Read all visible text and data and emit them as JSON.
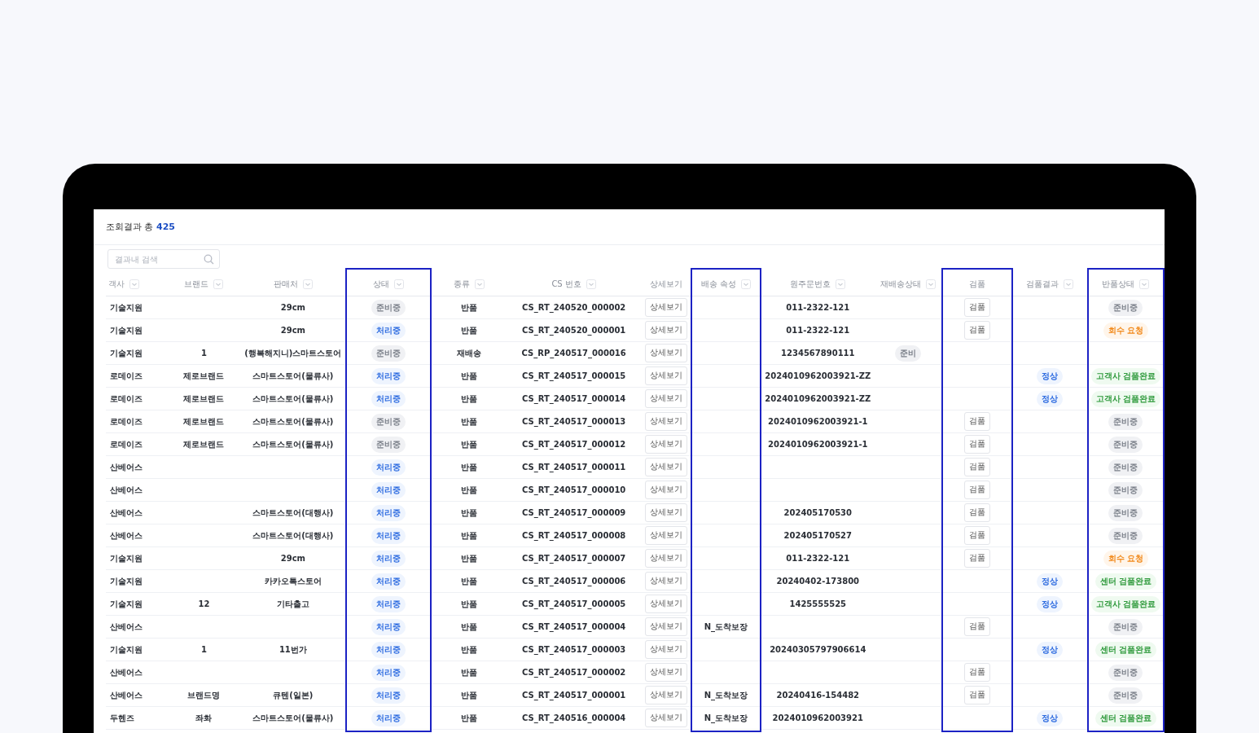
{
  "result_summary": {
    "label": "조회결과 총",
    "count": "425"
  },
  "search": {
    "placeholder": "결과내 검색"
  },
  "columns": [
    {
      "label": "객사",
      "sortable": true,
      "highlighted": false
    },
    {
      "label": "브랜드",
      "sortable": true,
      "highlighted": false
    },
    {
      "label": "판매처",
      "sortable": true,
      "highlighted": false
    },
    {
      "label": "상태",
      "sortable": true,
      "highlighted": true
    },
    {
      "label": "종류",
      "sortable": true,
      "highlighted": false
    },
    {
      "label": "CS 번호",
      "sortable": true,
      "highlighted": false
    },
    {
      "label": "상세보기",
      "sortable": false,
      "highlighted": false
    },
    {
      "label": "배송 속성",
      "sortable": true,
      "highlighted": true
    },
    {
      "label": "원주문번호",
      "sortable": true,
      "highlighted": false
    },
    {
      "label": "재배송상태",
      "sortable": true,
      "highlighted": false
    },
    {
      "label": "검품",
      "sortable": false,
      "highlighted": true
    },
    {
      "label": "검품결과",
      "sortable": true,
      "highlighted": false
    },
    {
      "label": "반품상태",
      "sortable": true,
      "highlighted": true
    }
  ],
  "rows": [
    {
      "customer": "기술지원",
      "seller": "29cm",
      "status": {
        "label": "준비중",
        "kind": "ready"
      },
      "type": "반품",
      "cs_no": "CS_RT_240520_000002",
      "detail": "상세보기",
      "order_no": "011-2322-121",
      "inspect": "검품",
      "return_status": {
        "label": "준비중",
        "kind": "ready"
      }
    },
    {
      "customer": "기술지원",
      "seller": "29cm",
      "status": {
        "label": "처리중",
        "kind": "processing"
      },
      "type": "반품",
      "cs_no": "CS_RT_240520_000001",
      "detail": "상세보기",
      "order_no": "011-2322-121",
      "inspect": "검품",
      "return_status": {
        "label": "회수 요청",
        "kind": "pickup"
      }
    },
    {
      "customer": "기술지원",
      "brand": "1",
      "seller": "(행복해지니)스마트스토어",
      "status": {
        "label": "준비중",
        "kind": "ready"
      },
      "type": "재배송",
      "cs_no": "CS_RP_240517_000016",
      "detail": "상세보기",
      "order_no": "1234567890111",
      "reship_status": {
        "label": "준비",
        "kind": "ready"
      }
    },
    {
      "customer": "로데이즈",
      "brand": "제로브랜드",
      "seller": "스마트스토어(물류사)",
      "status": {
        "label": "처리중",
        "kind": "processing"
      },
      "type": "반품",
      "cs_no": "CS_RT_240517_000015",
      "detail": "상세보기",
      "order_no": "2024010962003921-ZZ",
      "inspect_result": {
        "label": "정상",
        "kind": "processing"
      },
      "return_status": {
        "label": "고객사 검품완료",
        "kind": "complete"
      }
    },
    {
      "customer": "로데이즈",
      "brand": "제로브랜드",
      "seller": "스마트스토어(물류사)",
      "status": {
        "label": "처리중",
        "kind": "processing"
      },
      "type": "반품",
      "cs_no": "CS_RT_240517_000014",
      "detail": "상세보기",
      "order_no": "2024010962003921-ZZ",
      "inspect_result": {
        "label": "정상",
        "kind": "processing"
      },
      "return_status": {
        "label": "고객사 검품완료",
        "kind": "complete"
      }
    },
    {
      "customer": "로데이즈",
      "brand": "제로브랜드",
      "seller": "스마트스토어(물류사)",
      "status": {
        "label": "준비중",
        "kind": "ready"
      },
      "type": "반품",
      "cs_no": "CS_RT_240517_000013",
      "detail": "상세보기",
      "order_no": "2024010962003921-1",
      "inspect": "검품",
      "return_status": {
        "label": "준비중",
        "kind": "ready"
      }
    },
    {
      "customer": "로데이즈",
      "brand": "제로브랜드",
      "seller": "스마트스토어(물류사)",
      "status": {
        "label": "준비중",
        "kind": "ready"
      },
      "type": "반품",
      "cs_no": "CS_RT_240517_000012",
      "detail": "상세보기",
      "order_no": "2024010962003921-1",
      "inspect": "검품",
      "return_status": {
        "label": "준비중",
        "kind": "ready"
      }
    },
    {
      "customer": "산베어스",
      "status": {
        "label": "처리중",
        "kind": "processing"
      },
      "type": "반품",
      "cs_no": "CS_RT_240517_000011",
      "detail": "상세보기",
      "inspect": "검품",
      "return_status": {
        "label": "준비중",
        "kind": "ready"
      }
    },
    {
      "customer": "산베어스",
      "status": {
        "label": "처리중",
        "kind": "processing"
      },
      "type": "반품",
      "cs_no": "CS_RT_240517_000010",
      "detail": "상세보기",
      "inspect": "검품",
      "return_status": {
        "label": "준비중",
        "kind": "ready"
      }
    },
    {
      "customer": "산베어스",
      "seller": "스마트스토어(대행사)",
      "status": {
        "label": "처리중",
        "kind": "processing"
      },
      "type": "반품",
      "cs_no": "CS_RT_240517_000009",
      "detail": "상세보기",
      "order_no": "202405170530",
      "inspect": "검품",
      "return_status": {
        "label": "준비중",
        "kind": "ready"
      }
    },
    {
      "customer": "산베어스",
      "seller": "스마트스토어(대행사)",
      "status": {
        "label": "처리중",
        "kind": "processing"
      },
      "type": "반품",
      "cs_no": "CS_RT_240517_000008",
      "detail": "상세보기",
      "order_no": "202405170527",
      "inspect": "검품",
      "return_status": {
        "label": "준비중",
        "kind": "ready"
      }
    },
    {
      "customer": "기술지원",
      "seller": "29cm",
      "status": {
        "label": "처리중",
        "kind": "processing"
      },
      "type": "반품",
      "cs_no": "CS_RT_240517_000007",
      "detail": "상세보기",
      "order_no": "011-2322-121",
      "inspect": "검품",
      "return_status": {
        "label": "회수 요청",
        "kind": "pickup"
      }
    },
    {
      "customer": "기술지원",
      "seller": "카카오톡스토어",
      "status": {
        "label": "처리중",
        "kind": "processing"
      },
      "type": "반품",
      "cs_no": "CS_RT_240517_000006",
      "detail": "상세보기",
      "order_no": "20240402-173800",
      "inspect_result": {
        "label": "정상",
        "kind": "processing"
      },
      "return_status": {
        "label": "센터 검품완료",
        "kind": "complete"
      }
    },
    {
      "customer": "기술지원",
      "brand": "12",
      "seller": "기타출고",
      "status": {
        "label": "처리중",
        "kind": "processing"
      },
      "type": "반품",
      "cs_no": "CS_RT_240517_000005",
      "detail": "상세보기",
      "order_no": "1425555525",
      "inspect_result": {
        "label": "정상",
        "kind": "processing"
      },
      "return_status": {
        "label": "고객사 검품완료",
        "kind": "complete"
      }
    },
    {
      "customer": "산베어스",
      "status": {
        "label": "처리중",
        "kind": "processing"
      },
      "type": "반품",
      "cs_no": "CS_RT_240517_000004",
      "detail": "상세보기",
      "delivery_attr": "N_도착보장",
      "inspect": "검품",
      "return_status": {
        "label": "준비중",
        "kind": "ready"
      }
    },
    {
      "customer": "기술지원",
      "brand": "1",
      "seller": "11번가",
      "status": {
        "label": "처리중",
        "kind": "processing"
      },
      "type": "반품",
      "cs_no": "CS_RT_240517_000003",
      "detail": "상세보기",
      "order_no": "20240305797906614",
      "inspect_result": {
        "label": "정상",
        "kind": "processing"
      },
      "return_status": {
        "label": "센터 검품완료",
        "kind": "complete"
      }
    },
    {
      "customer": "산베어스",
      "status": {
        "label": "처리중",
        "kind": "processing"
      },
      "type": "반품",
      "cs_no": "CS_RT_240517_000002",
      "detail": "상세보기",
      "inspect": "검품",
      "return_status": {
        "label": "준비중",
        "kind": "ready"
      }
    },
    {
      "customer": "산베어스",
      "brand": "브랜드명",
      "seller": "큐텐(일본)",
      "status": {
        "label": "처리중",
        "kind": "processing"
      },
      "type": "반품",
      "cs_no": "CS_RT_240517_000001",
      "detail": "상세보기",
      "delivery_attr": "N_도착보장",
      "order_no": "20240416-154482",
      "inspect": "검품",
      "return_status": {
        "label": "준비중",
        "kind": "ready"
      }
    },
    {
      "customer": "두헨즈",
      "brand": "좌화",
      "seller": "스마트스토어(물류사)",
      "status": {
        "label": "처리중",
        "kind": "processing"
      },
      "type": "반품",
      "cs_no": "CS_RT_240516_000004",
      "detail": "상세보기",
      "delivery_attr": "N_도착보장",
      "order_no": "2024010962003921",
      "inspect_result": {
        "label": "정상",
        "kind": "processing"
      },
      "return_status": {
        "label": "센터 검품완료",
        "kind": "complete"
      }
    }
  ]
}
